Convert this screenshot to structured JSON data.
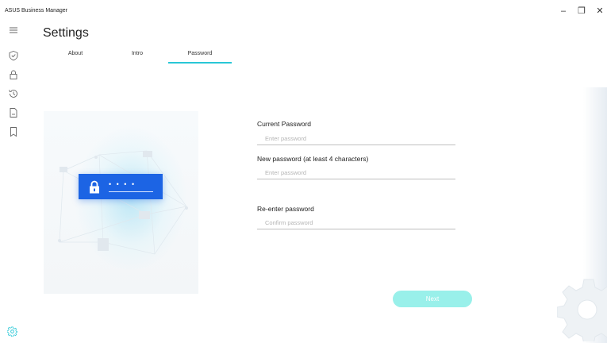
{
  "window": {
    "title": "ASUS Business Manager",
    "controls": {
      "minimize": "–",
      "maximize": "❐",
      "close": "✕"
    }
  },
  "nav": {
    "items": [
      {
        "icon": "hamburger-menu-icon"
      },
      {
        "icon": "shield-check-icon"
      },
      {
        "icon": "lock-icon"
      },
      {
        "icon": "history-icon"
      },
      {
        "icon": "document-icon"
      },
      {
        "icon": "bookmark-icon"
      }
    ],
    "footer_icon": "settings-gear-icon"
  },
  "page": {
    "title": "Settings",
    "tabs": [
      {
        "label": "About",
        "active": false
      },
      {
        "label": "Intro",
        "active": false
      },
      {
        "label": "Password",
        "active": true
      }
    ]
  },
  "illustration": {
    "masked_password": "• • • •"
  },
  "form": {
    "current_password": {
      "label": "Current Password",
      "placeholder": "Enter password",
      "value": ""
    },
    "new_password": {
      "label": "New password (at least 4 characters)",
      "placeholder": "Enter password",
      "value": ""
    },
    "confirm_password": {
      "label": "Re-enter password",
      "placeholder": "Confirm password",
      "value": ""
    },
    "next_label": "Next"
  },
  "colors": {
    "accent": "#29c7d6",
    "next_button": "#99f0ea",
    "lock_card": "#1c64e4"
  }
}
